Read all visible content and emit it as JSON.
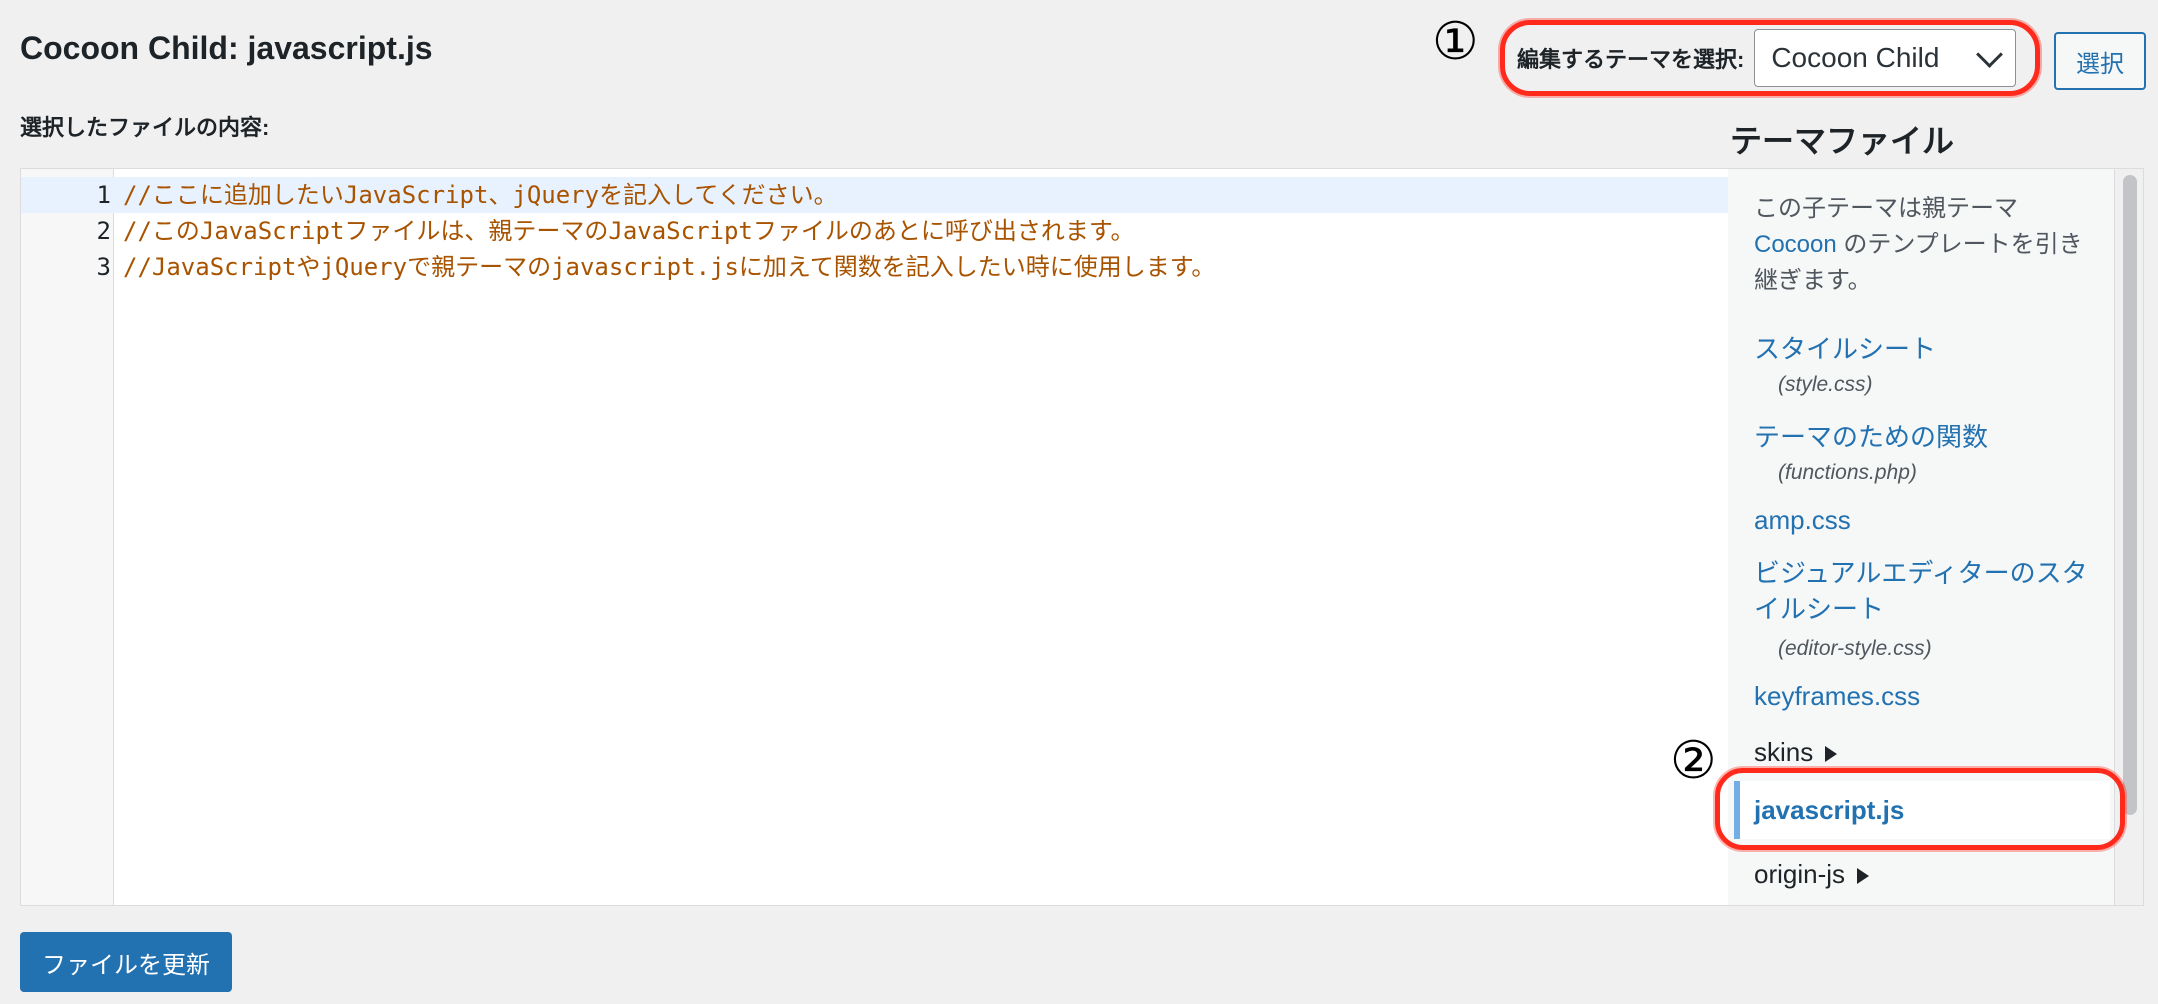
{
  "page": {
    "title": "Cocoon Child: javascript.js",
    "file_content_label": "選択したファイルの内容:"
  },
  "annotations": {
    "marker1": "①",
    "marker2": "②"
  },
  "theme_picker": {
    "label": "編集するテーマを選択:",
    "selected": "Cocoon Child",
    "button": "選択"
  },
  "editor": {
    "lines": [
      {
        "no": "1",
        "text": "//ここに追加したいJavaScript、jQueryを記入してください。"
      },
      {
        "no": "2",
        "text": "//このJavaScriptファイルは、親テーマのJavaScriptファイルのあとに呼び出されます。"
      },
      {
        "no": "3",
        "text": "//JavaScriptやjQueryで親テーマのjavascript.jsに加えて関数を記入したい時に使用します。"
      }
    ]
  },
  "theme_files": {
    "heading": "テーマファイル",
    "note_before": "この子テーマは親テーマ",
    "note_parent": "Cocoon",
    "note_after": "のテンプレートを引き継ぎます。",
    "files": [
      {
        "label": "スタイルシート",
        "sub": "(style.css)"
      },
      {
        "label": "テーマのための関数",
        "sub": "(functions.php)"
      },
      {
        "label": "amp.css"
      },
      {
        "label": "ビジュアルエディターのスタイルシート",
        "sub": "(editor-style.css)"
      },
      {
        "label": "keyframes.css"
      }
    ],
    "folder_skins": "skins",
    "current_file": "javascript.js",
    "folder_origin_js": "origin-js"
  },
  "footer": {
    "update_button": "ファイルを更新"
  }
}
